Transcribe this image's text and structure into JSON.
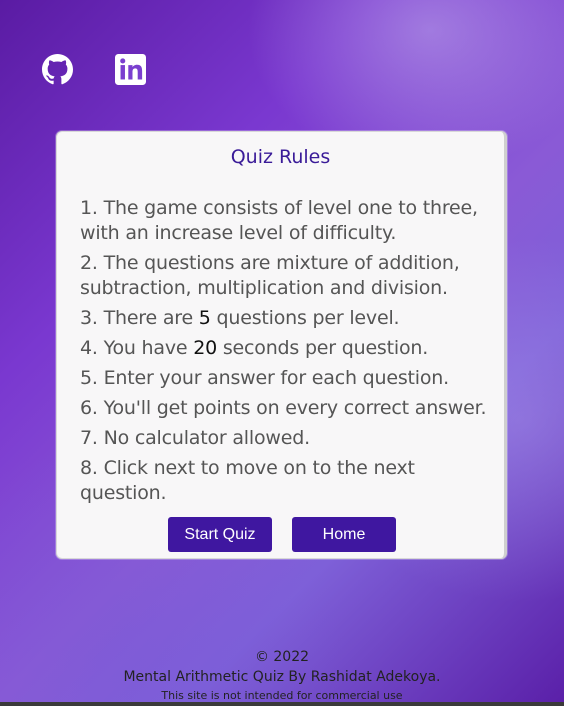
{
  "social": {
    "github_label": "GitHub",
    "linkedin_label": "LinkedIn"
  },
  "card": {
    "title": "Quiz Rules",
    "rules": [
      {
        "pre": "1. The game consists of level one to three, with an increase level of difficulty.",
        "num": "",
        "post": ""
      },
      {
        "pre": "2. The questions are mixture of addition, subtraction, multiplication and division.",
        "num": "",
        "post": ""
      },
      {
        "pre": "3. There are ",
        "num": "5",
        "post": " questions per level."
      },
      {
        "pre": "4. You have ",
        "num": "20",
        "post": " seconds per question."
      },
      {
        "pre": "5. Enter your answer for each question.",
        "num": "",
        "post": ""
      },
      {
        "pre": "6. You'll get points on every correct answer.",
        "num": "",
        "post": ""
      },
      {
        "pre": "7. No calculator allowed.",
        "num": "",
        "post": ""
      },
      {
        "pre": "8. Click next to move on to the next question.",
        "num": "",
        "post": ""
      }
    ],
    "start_label": "Start Quiz",
    "home_label": "Home"
  },
  "footer": {
    "copyright": "© 2022",
    "credit": "Mental Arithmetic Quiz By Rashidat Adekoya.",
    "note": "This site is not intended for commercial use"
  },
  "colors": {
    "accent": "#3f17a0",
    "title": "#3a1b98",
    "card_bg": "#f8f7f8"
  }
}
